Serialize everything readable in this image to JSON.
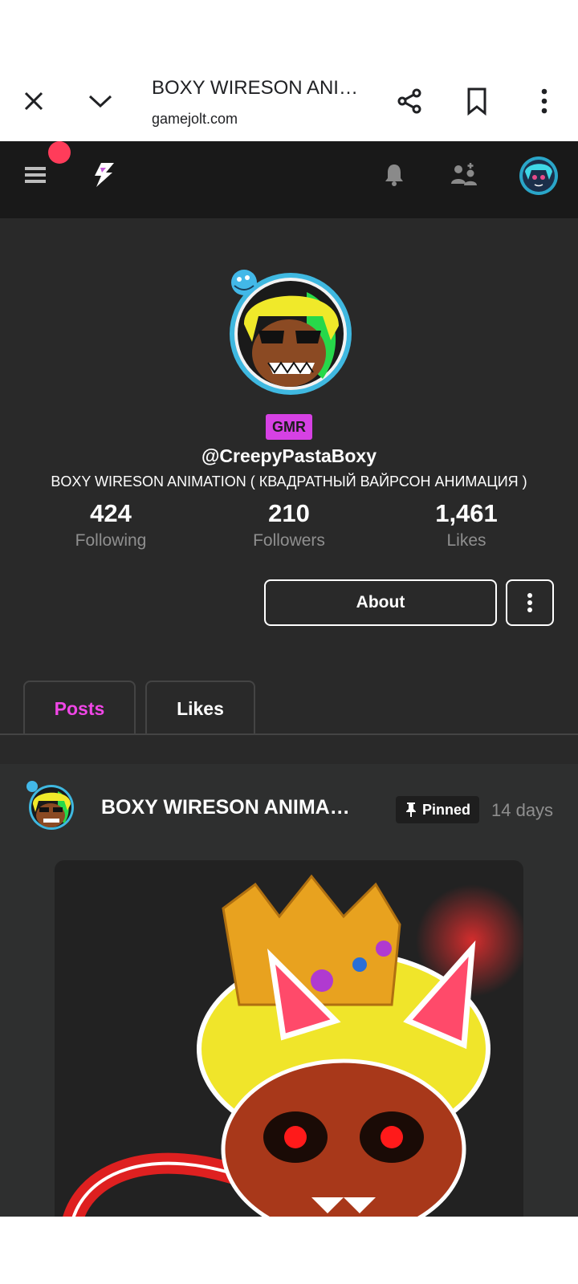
{
  "browser": {
    "page_title": "BOXY WIRESON ANI…",
    "domain": "gamejolt.com"
  },
  "profile": {
    "badge": "GMR",
    "username": "@CreepyPastaBoxy",
    "display_name": "BOXY WIRESON ANIMATION ( КВАДРАТНЫЙ ВАЙРСОН АНИМАЦИЯ )",
    "stats": [
      {
        "value": "424",
        "label": "Following"
      },
      {
        "value": "210",
        "label": "Followers"
      },
      {
        "value": "1,461",
        "label": "Likes"
      }
    ],
    "about_label": "About"
  },
  "tabs": [
    {
      "label": "Posts",
      "active": true
    },
    {
      "label": "Likes",
      "active": false
    }
  ],
  "post": {
    "title": "BOXY WIRESON ANIMA…",
    "pinned_label": "Pinned",
    "time": "14 days"
  },
  "colors": {
    "accent": "#f046e6",
    "nav_bg": "#191919",
    "profile_bg": "#292929",
    "notif": "#ff3c5a"
  }
}
